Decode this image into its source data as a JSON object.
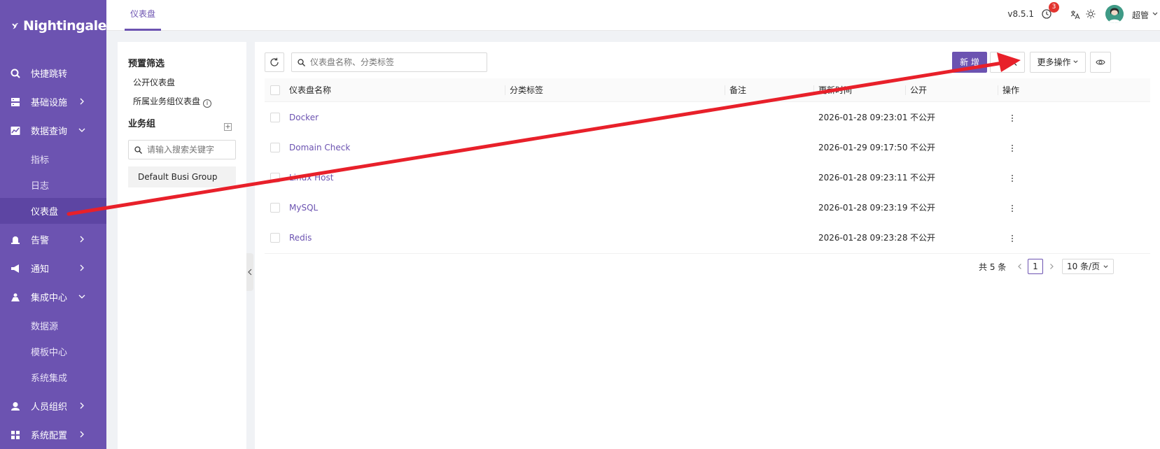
{
  "brand": {
    "name": "Nightingale",
    "accent": "#6c53b1"
  },
  "sidebar": {
    "items": [
      {
        "label": "快捷跳转",
        "icon": "search-icon",
        "expandable": false
      },
      {
        "label": "基础设施",
        "icon": "server-icon",
        "expandable": true
      },
      {
        "label": "数据查询",
        "icon": "chart-icon",
        "expandable": true,
        "expanded": true,
        "children": [
          {
            "label": "指标"
          },
          {
            "label": "日志"
          },
          {
            "label": "仪表盘",
            "active": true
          }
        ]
      },
      {
        "label": "告警",
        "icon": "alarm-icon",
        "expandable": true
      },
      {
        "label": "通知",
        "icon": "megaphone-icon",
        "expandable": true
      },
      {
        "label": "集成中心",
        "icon": "integration-icon",
        "expandable": true,
        "expanded": true,
        "children": [
          {
            "label": "数据源"
          },
          {
            "label": "模板中心"
          },
          {
            "label": "系统集成"
          }
        ]
      },
      {
        "label": "人员组织",
        "icon": "user-icon",
        "expandable": true
      },
      {
        "label": "系统配置",
        "icon": "grid-icon",
        "expandable": true
      }
    ]
  },
  "topbar": {
    "tab": "仪表盘",
    "version": "v8.5.1",
    "notification_count": "3",
    "username": "超管"
  },
  "filter_panel": {
    "preset_title": "预置筛选",
    "preset_items": [
      "公开仪表盘",
      "所属业务组仪表盘"
    ],
    "group_title": "业务组",
    "search_placeholder": "请输入搜索关键字",
    "groups": [
      "Default Busi Group"
    ]
  },
  "toolbar": {
    "search_placeholder": "仪表盘名称、分类标签",
    "new_label": "新 增",
    "import_label": "导 入",
    "more_label": "更多操作"
  },
  "table": {
    "columns": [
      "仪表盘名称",
      "分类标签",
      "备注",
      "更新时间",
      "公开",
      "操作"
    ],
    "rows": [
      {
        "name": "Docker",
        "tags": "",
        "note": "",
        "updated": "2026-01-28 09:23:01",
        "public": "不公开"
      },
      {
        "name": "Domain Check",
        "tags": "",
        "note": "",
        "updated": "2026-01-29 09:17:50",
        "public": "不公开"
      },
      {
        "name": "Linux Host",
        "tags": "",
        "note": "",
        "updated": "2026-01-28 09:23:11",
        "public": "不公开"
      },
      {
        "name": "MySQL",
        "tags": "",
        "note": "",
        "updated": "2026-01-28 09:23:19",
        "public": "不公开"
      },
      {
        "name": "Redis",
        "tags": "",
        "note": "",
        "updated": "2026-01-28 09:23:28",
        "public": "不公开"
      }
    ]
  },
  "pagination": {
    "total": "共 5 条",
    "current": "1",
    "page_size": "10 条/页"
  },
  "annotation": {
    "color": "#e8202a",
    "description": "arrow from sidebar 仪表盘 to 导入 button"
  }
}
